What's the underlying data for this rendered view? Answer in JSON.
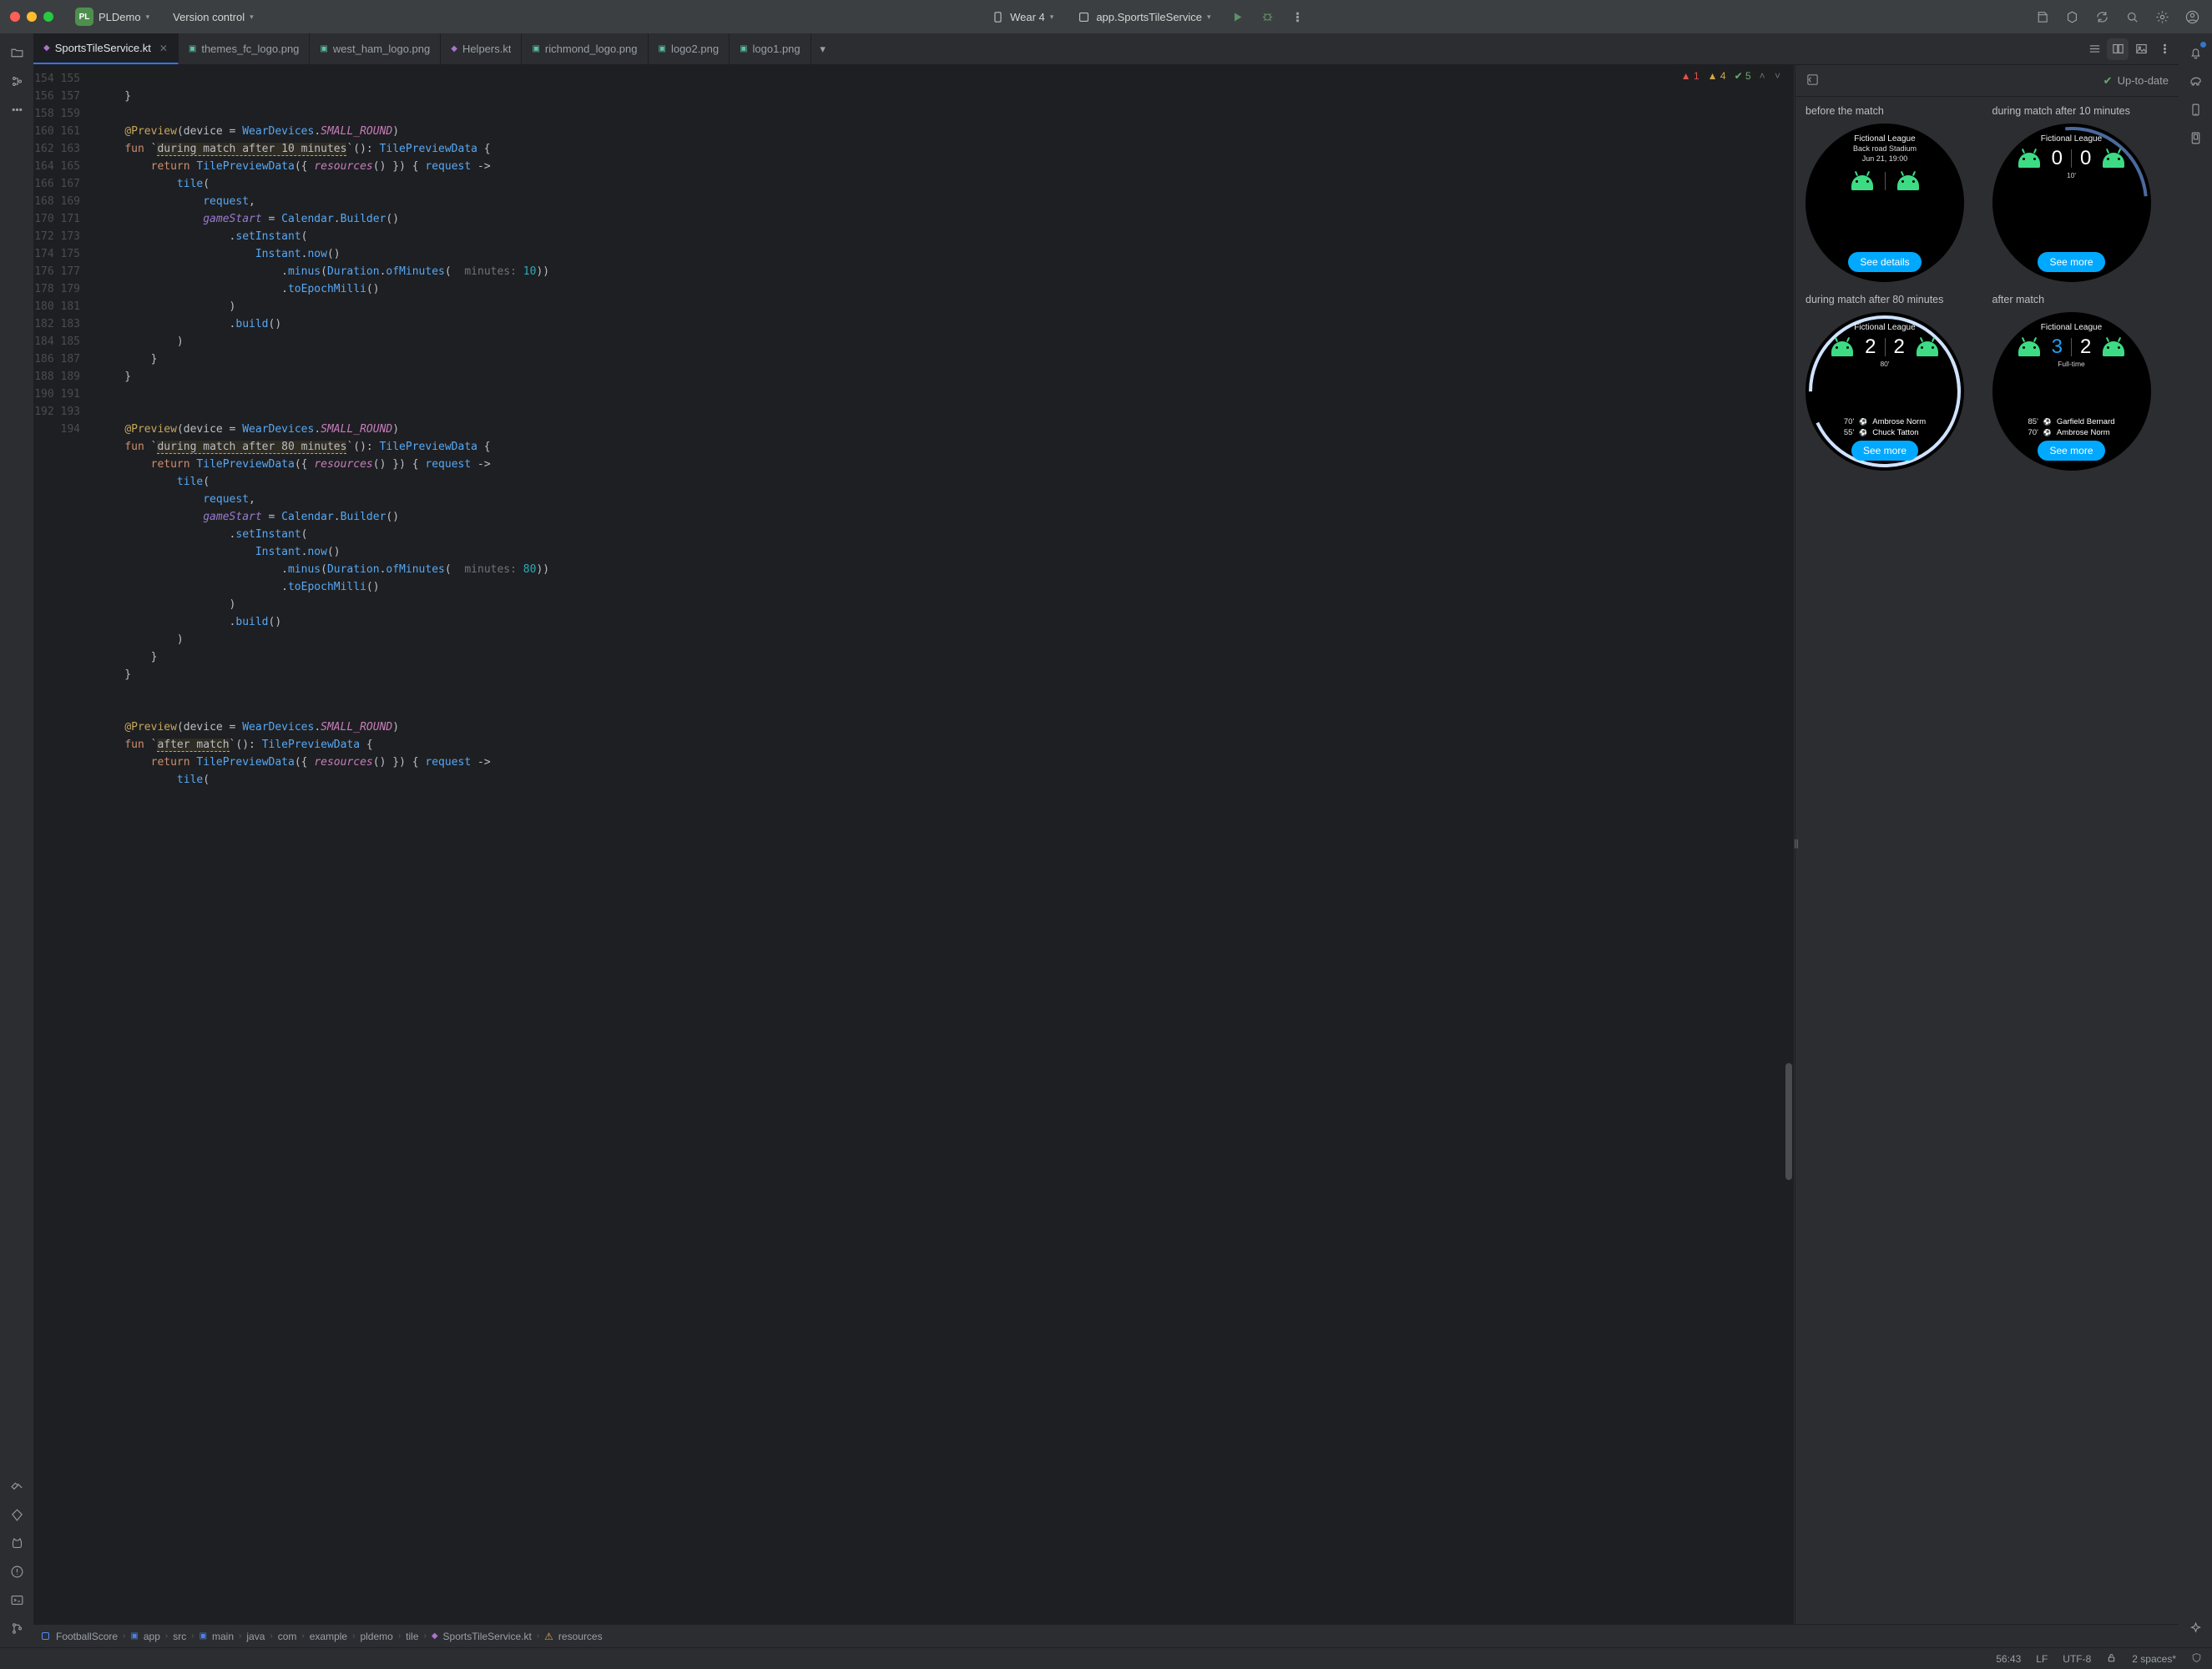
{
  "window": {
    "project_badge": "PL",
    "project_name": "PLDemo",
    "vcs_menu": "Version control",
    "device_label": "Wear 4",
    "run_config": "app.SportsTileService"
  },
  "tabs": [
    {
      "label": "SportsTileService.kt",
      "kind": "kt",
      "active": true
    },
    {
      "label": "themes_fc_logo.png",
      "kind": "img"
    },
    {
      "label": "west_ham_logo.png",
      "kind": "img"
    },
    {
      "label": "Helpers.kt",
      "kind": "kt"
    },
    {
      "label": "richmond_logo.png",
      "kind": "img"
    },
    {
      "label": "logo2.png",
      "kind": "img"
    },
    {
      "label": "logo1.png",
      "kind": "img",
      "trunc": true
    }
  ],
  "inspections": {
    "errors": "1",
    "warnings": "4",
    "oks": "5"
  },
  "code": {
    "first_line": 154,
    "lines": [
      "",
      "    }",
      "",
      "    @Preview(device = WearDevices.SMALL_ROUND)",
      "    fun `during match after 10 minutes`(): TilePreviewData {",
      "        return TilePreviewData({ resources() }) { request ->",
      "            tile(",
      "                request,",
      "                gameStart = Calendar.Builder()",
      "                    .setInstant(",
      "                        Instant.now()",
      "                            .minus(Duration.ofMinutes( minutes: 10))",
      "                            .toEpochMilli()",
      "                    )",
      "                    .build()",
      "            )",
      "        }",
      "    }",
      "",
      "",
      "    @Preview(device = WearDevices.SMALL_ROUND)",
      "    fun `during match after 80 minutes`(): TilePreviewData {",
      "        return TilePreviewData({ resources() }) { request ->",
      "            tile(",
      "                request,",
      "                gameStart = Calendar.Builder()",
      "                    .setInstant(",
      "                        Instant.now()",
      "                            .minus(Duration.ofMinutes( minutes: 80))",
      "                            .toEpochMilli()",
      "                    )",
      "                    .build()",
      "            )",
      "        }",
      "    }",
      "",
      "",
      "    @Preview(device = WearDevices.SMALL_ROUND)",
      "    fun `after match`(): TilePreviewData {",
      "        return TilePreviewData({ resources() }) { request ->",
      "            tile("
    ]
  },
  "preview": {
    "status": "Up-to-date",
    "cells": [
      {
        "label": "before the match",
        "league": "Fictional League",
        "sub1": "Back road Stadium",
        "sub2": "Jun 21, 19:00",
        "button": "See details"
      },
      {
        "label": "during match after 10 minutes",
        "league": "Fictional League",
        "score_home": "0",
        "score_away": "0",
        "minute": "10'",
        "button": "See more"
      },
      {
        "label": "during match after 80 minutes",
        "league": "Fictional League",
        "score_home": "2",
        "score_away": "2",
        "minute": "80'",
        "goals": [
          {
            "min": "70'",
            "name": "Ambrose Norm"
          },
          {
            "min": "55'",
            "name": "Chuck Tatton"
          }
        ],
        "button": "See more"
      },
      {
        "label": "after match",
        "league": "Fictional League",
        "score_home": "3",
        "score_away": "2",
        "winner": "home",
        "minute": "Full-time",
        "goals": [
          {
            "min": "85'",
            "name": "Garfield Bernard"
          },
          {
            "min": "70'",
            "name": "Ambrose Norm"
          }
        ],
        "button": "See more"
      }
    ]
  },
  "breadcrumbs": [
    "FootballScore",
    "app",
    "src",
    "main",
    "java",
    "com",
    "example",
    "pldemo",
    "tile",
    "SportsTileService.kt",
    "resources"
  ],
  "status": {
    "caret": "56:43",
    "line_sep": "LF",
    "encoding": "UTF-8",
    "indent": "2 spaces*"
  }
}
